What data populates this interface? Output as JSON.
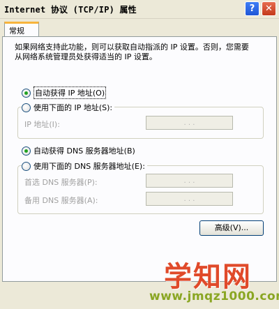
{
  "window": {
    "title": "Internet 协议 (TCP/IP) 属性",
    "help_glyph": "?",
    "close_glyph": "✕"
  },
  "tabs": [
    {
      "label": "常规",
      "selected": true
    }
  ],
  "description": "如果网络支持此功能，则可以获取自动指派的 IP 设置。否则，您需要从网络系统管理员处获得适当的 IP 设置。",
  "ip_section": {
    "auto_label": "自动获得 IP 地址(O)",
    "auto_selected": true,
    "manual_label": "使用下面的 IP 地址(S):",
    "manual_selected": false,
    "ip_address_label": "IP 地址(I):",
    "ip_address_value": ". . ."
  },
  "dns_section": {
    "auto_label": "自动获得 DNS 服务器地址(B)",
    "auto_selected": true,
    "manual_label": "使用下面的 DNS 服务器地址(E):",
    "manual_selected": false,
    "preferred_label": "首选 DNS 服务器(P):",
    "preferred_value": ". . .",
    "alternate_label": "备用 DNS 服务器(A):",
    "alternate_value": ". . ."
  },
  "advanced_button": "高级(V)...",
  "watermark": {
    "text": "学知网",
    "url": "www.jmqz1000.com"
  },
  "colors": {
    "accent_tab": "#f8b43c",
    "radio_selected": "#21a121",
    "watermark": "#e04a2a",
    "watermark_url": "#8aa623"
  }
}
